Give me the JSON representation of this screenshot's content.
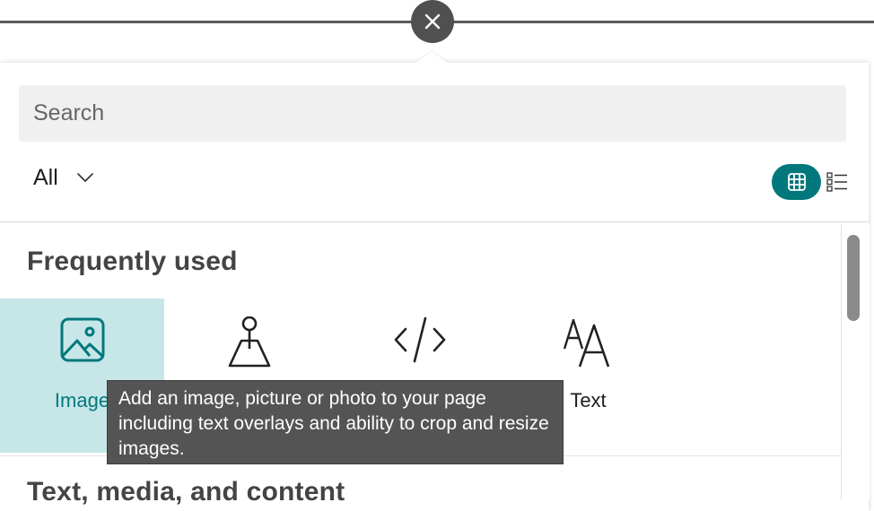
{
  "search": {
    "placeholder": "Search",
    "value": ""
  },
  "filter": {
    "label": "All"
  },
  "sections": [
    {
      "heading": "Frequently used"
    },
    {
      "heading": "Text, media, and content"
    }
  ],
  "tiles": [
    {
      "label": "Image",
      "icon": "image-icon",
      "selected": true
    },
    {
      "label": "",
      "icon": "map-pin-icon",
      "selected": false
    },
    {
      "label": "",
      "icon": "code-embed-icon",
      "selected": false
    },
    {
      "label": "Text",
      "icon": "text-font-icon",
      "selected": false
    }
  ],
  "tooltip": {
    "text": "Add an image, picture or photo to your page including text overlays and ability to crop and resize images."
  },
  "colors": {
    "accent": "#03787c",
    "selected_bg": "#c7e6e8",
    "tooltip_bg": "#545454"
  }
}
